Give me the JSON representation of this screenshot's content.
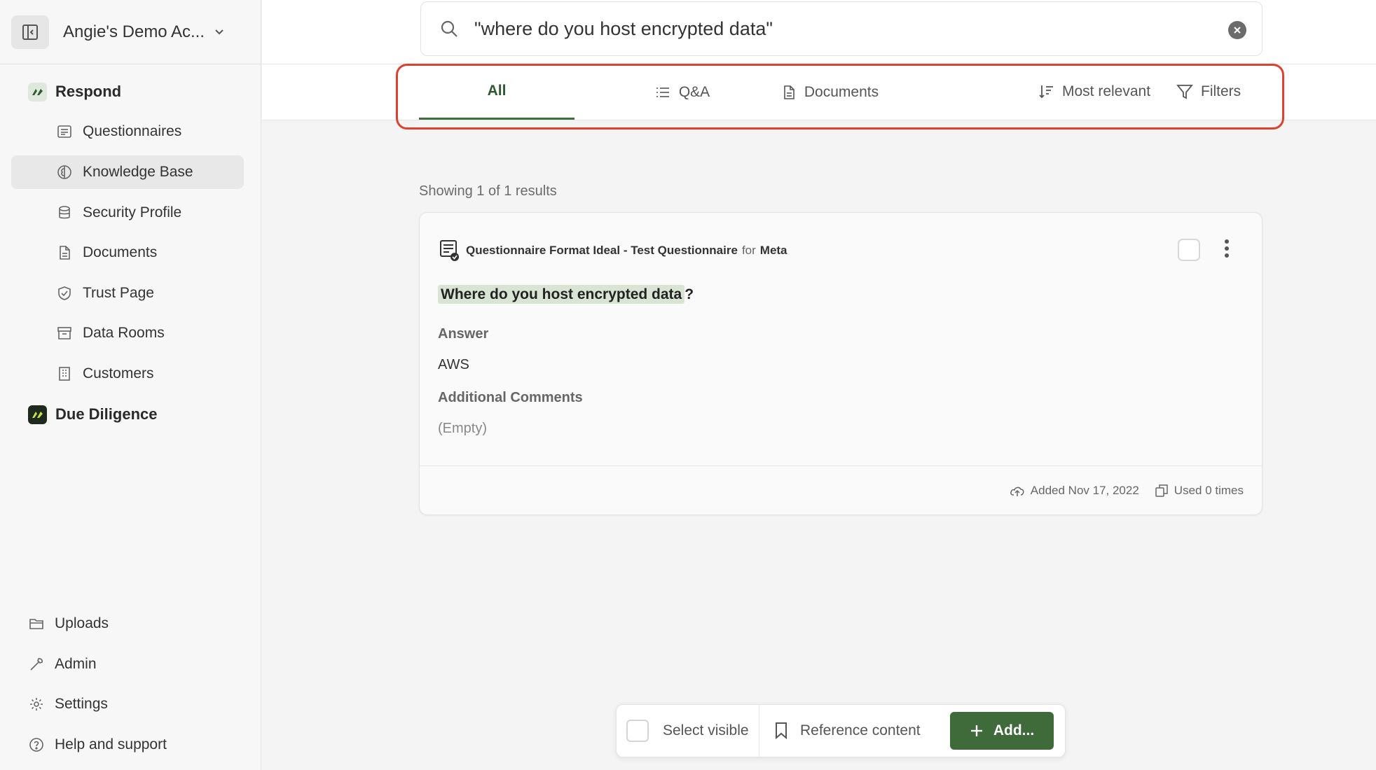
{
  "account": {
    "name": "Angie's Demo Ac..."
  },
  "sidebar": {
    "sections": [
      {
        "label": "Respond",
        "badge_color": "#2f5a2f"
      },
      {
        "label": "Due Diligence",
        "badge_color": "#1f2a1f"
      }
    ],
    "items": [
      {
        "label": "Questionnaires",
        "icon": "document-list-icon"
      },
      {
        "label": "Knowledge Base",
        "icon": "brain-icon"
      },
      {
        "label": "Security Profile",
        "icon": "database-icon"
      },
      {
        "label": "Documents",
        "icon": "document-icon"
      },
      {
        "label": "Trust Page",
        "icon": "shield-check-icon"
      },
      {
        "label": "Data Rooms",
        "icon": "archive-icon"
      },
      {
        "label": "Customers",
        "icon": "building-icon"
      }
    ],
    "footer": [
      {
        "label": "Uploads",
        "icon": "folder-icon"
      },
      {
        "label": "Admin",
        "icon": "wrench-icon"
      },
      {
        "label": "Settings",
        "icon": "gear-icon"
      },
      {
        "label": "Help and support",
        "icon": "help-circle-icon"
      }
    ]
  },
  "search": {
    "query": "\"where do you host encrypted data\""
  },
  "tabs": [
    {
      "label": "All"
    },
    {
      "label": "Q&A"
    },
    {
      "label": "Documents"
    }
  ],
  "toolbar": {
    "sort_label": "Most relevant",
    "filters_label": "Filters"
  },
  "results": {
    "summary": "Showing 1 of 1 results",
    "card": {
      "source": "Questionnaire Format Ideal - Test Questionnaire",
      "for_word": "for",
      "company": "Meta",
      "question_highlight": "Where do you host encrypted data",
      "question_suffix": "?",
      "answer_label": "Answer",
      "answer": "AWS",
      "comments_label": "Additional Comments",
      "comments": "(Empty)",
      "added": "Added Nov 17, 2022",
      "used": "Used 0 times"
    }
  },
  "actionbar": {
    "select_visible": "Select visible",
    "reference_content": "Reference content",
    "add": "Add..."
  },
  "colors": {
    "accent": "#3f6a3a",
    "highlight_border": "#e0412f"
  }
}
